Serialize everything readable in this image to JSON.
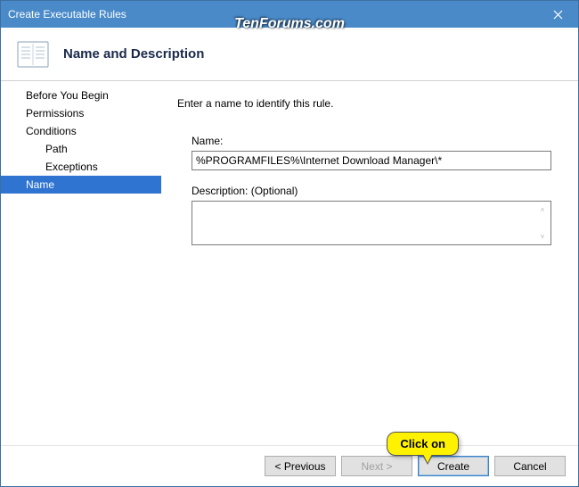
{
  "titlebar": {
    "title": "Create Executable Rules"
  },
  "watermark": "TenForums.com",
  "header": {
    "title": "Name and Description"
  },
  "sidebar": {
    "items": [
      {
        "label": "Before You Begin",
        "indent": false,
        "selected": false
      },
      {
        "label": "Permissions",
        "indent": false,
        "selected": false
      },
      {
        "label": "Conditions",
        "indent": false,
        "selected": false
      },
      {
        "label": "Path",
        "indent": true,
        "selected": false
      },
      {
        "label": "Exceptions",
        "indent": true,
        "selected": false
      },
      {
        "label": "Name",
        "indent": false,
        "selected": true
      }
    ]
  },
  "content": {
    "instruction": "Enter a name to identify this rule.",
    "name_label": "Name:",
    "name_value": "%PROGRAMFILES%\\Internet Download Manager\\*",
    "desc_label": "Description: (Optional)",
    "desc_value": ""
  },
  "footer": {
    "previous": "< Previous",
    "next": "Next >",
    "create": "Create",
    "cancel": "Cancel"
  },
  "callout": {
    "text": "Click on"
  }
}
